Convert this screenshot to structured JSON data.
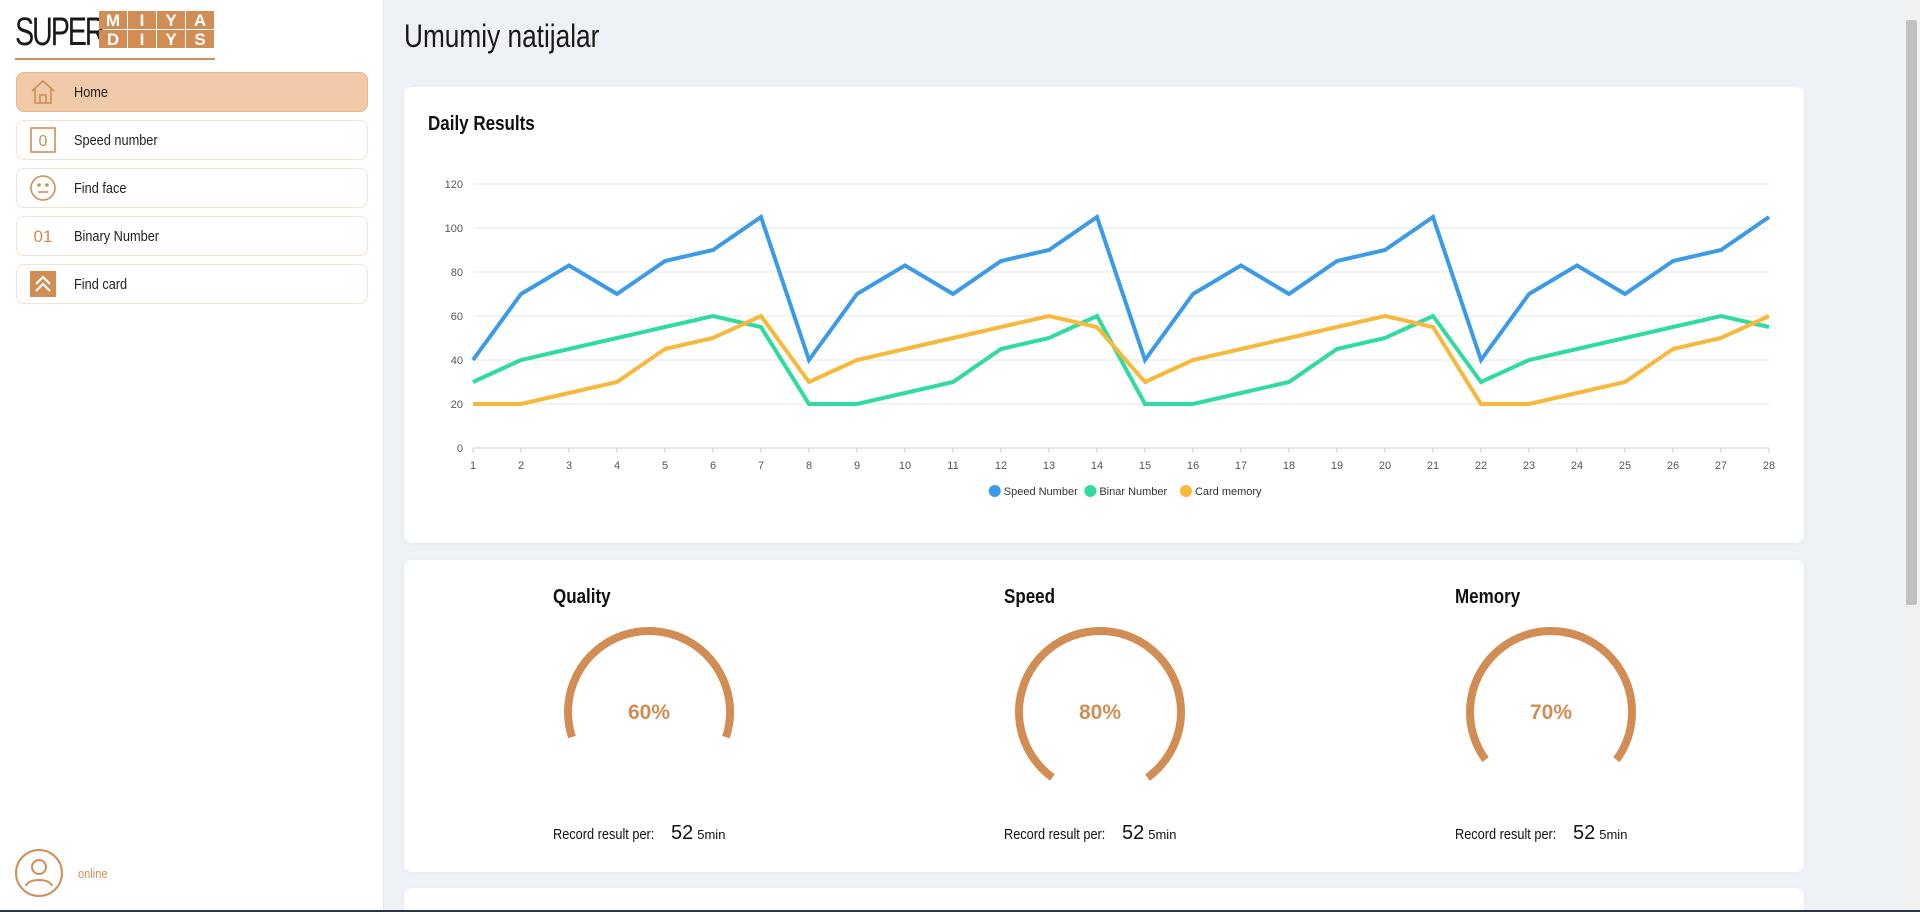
{
  "sidebar": {
    "logo": {
      "word": "SUPER",
      "blocks": [
        "M",
        "Ι",
        "Y",
        "A",
        "D",
        "Ι",
        "Y",
        "S"
      ]
    },
    "items": [
      {
        "label": "Home",
        "icon": "home-icon",
        "active": true
      },
      {
        "label": "Speed number",
        "icon": "zero-box-icon",
        "active": false
      },
      {
        "label": "Find face",
        "icon": "face-icon",
        "active": false
      },
      {
        "label": "Binary Number",
        "icon": "binary-icon",
        "active": false
      },
      {
        "label": "Find card",
        "icon": "chevrons-up-icon",
        "active": false
      }
    ],
    "status": "online"
  },
  "page": {
    "title": "Umumiy natijalar"
  },
  "chart_card": {
    "title": "Daily Results"
  },
  "chart_data": {
    "type": "line",
    "title": "Daily Results",
    "x": [
      1,
      2,
      3,
      4,
      5,
      6,
      7,
      8,
      9,
      10,
      11,
      12,
      13,
      14,
      15,
      16,
      17,
      18,
      19,
      20,
      21,
      22,
      23,
      24,
      25,
      26,
      27,
      28
    ],
    "ylim": [
      0,
      120
    ],
    "yticks": [
      0,
      20,
      40,
      60,
      80,
      100,
      120
    ],
    "grid": true,
    "legend_position": "bottom",
    "series": [
      {
        "name": "Speed Number",
        "color": "#3b9be8",
        "values": [
          40,
          70,
          83,
          70,
          85,
          90,
          105,
          40,
          70,
          83,
          70,
          85,
          90,
          105,
          40,
          70,
          83,
          70,
          85,
          90,
          105,
          40,
          70,
          83,
          70,
          85,
          90,
          105
        ]
      },
      {
        "name": "Binar Number",
        "color": "#2fdb9e",
        "values": [
          30,
          40,
          45,
          50,
          55,
          60,
          55,
          20,
          20,
          25,
          30,
          45,
          50,
          60,
          20,
          20,
          25,
          30,
          45,
          50,
          60,
          30,
          40,
          45,
          50,
          55,
          60,
          55
        ]
      },
      {
        "name": "Card memory",
        "color": "#f6b93b",
        "values": [
          20,
          20,
          25,
          30,
          45,
          50,
          60,
          30,
          40,
          45,
          50,
          55,
          60,
          55,
          30,
          40,
          45,
          50,
          55,
          60,
          55,
          20,
          20,
          25,
          30,
          45,
          50,
          60
        ]
      }
    ]
  },
  "stats": [
    {
      "title": "Quality",
      "percent": 60,
      "percent_label": "60%",
      "record_label": "Record result per:",
      "record_value": "52",
      "record_unit": "5min"
    },
    {
      "title": "Speed",
      "percent": 80,
      "percent_label": "80%",
      "record_label": "Record result per:",
      "record_value": "52",
      "record_unit": "5min"
    },
    {
      "title": "Memory",
      "percent": 70,
      "percent_label": "70%",
      "record_label": "Record result per:",
      "record_value": "52",
      "record_unit": "5min"
    }
  ],
  "colors": {
    "accent": "#d18d54",
    "active_bg": "#efc9a8",
    "page_bg": "#eef1f5"
  }
}
